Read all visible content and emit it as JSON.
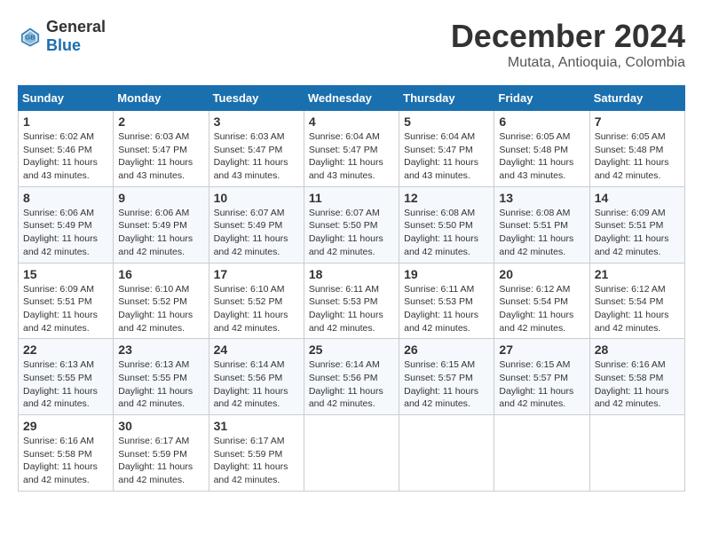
{
  "header": {
    "logo_general": "General",
    "logo_blue": "Blue",
    "month_title": "December 2024",
    "location": "Mutata, Antioquia, Colombia"
  },
  "days_of_week": [
    "Sunday",
    "Monday",
    "Tuesday",
    "Wednesday",
    "Thursday",
    "Friday",
    "Saturday"
  ],
  "weeks": [
    [
      {
        "day": "1",
        "sunrise": "6:02 AM",
        "sunset": "5:46 PM",
        "daylight": "11 hours and 43 minutes."
      },
      {
        "day": "2",
        "sunrise": "6:03 AM",
        "sunset": "5:47 PM",
        "daylight": "11 hours and 43 minutes."
      },
      {
        "day": "3",
        "sunrise": "6:03 AM",
        "sunset": "5:47 PM",
        "daylight": "11 hours and 43 minutes."
      },
      {
        "day": "4",
        "sunrise": "6:04 AM",
        "sunset": "5:47 PM",
        "daylight": "11 hours and 43 minutes."
      },
      {
        "day": "5",
        "sunrise": "6:04 AM",
        "sunset": "5:47 PM",
        "daylight": "11 hours and 43 minutes."
      },
      {
        "day": "6",
        "sunrise": "6:05 AM",
        "sunset": "5:48 PM",
        "daylight": "11 hours and 43 minutes."
      },
      {
        "day": "7",
        "sunrise": "6:05 AM",
        "sunset": "5:48 PM",
        "daylight": "11 hours and 42 minutes."
      }
    ],
    [
      {
        "day": "8",
        "sunrise": "6:06 AM",
        "sunset": "5:49 PM",
        "daylight": "11 hours and 42 minutes."
      },
      {
        "day": "9",
        "sunrise": "6:06 AM",
        "sunset": "5:49 PM",
        "daylight": "11 hours and 42 minutes."
      },
      {
        "day": "10",
        "sunrise": "6:07 AM",
        "sunset": "5:49 PM",
        "daylight": "11 hours and 42 minutes."
      },
      {
        "day": "11",
        "sunrise": "6:07 AM",
        "sunset": "5:50 PM",
        "daylight": "11 hours and 42 minutes."
      },
      {
        "day": "12",
        "sunrise": "6:08 AM",
        "sunset": "5:50 PM",
        "daylight": "11 hours and 42 minutes."
      },
      {
        "day": "13",
        "sunrise": "6:08 AM",
        "sunset": "5:51 PM",
        "daylight": "11 hours and 42 minutes."
      },
      {
        "day": "14",
        "sunrise": "6:09 AM",
        "sunset": "5:51 PM",
        "daylight": "11 hours and 42 minutes."
      }
    ],
    [
      {
        "day": "15",
        "sunrise": "6:09 AM",
        "sunset": "5:51 PM",
        "daylight": "11 hours and 42 minutes."
      },
      {
        "day": "16",
        "sunrise": "6:10 AM",
        "sunset": "5:52 PM",
        "daylight": "11 hours and 42 minutes."
      },
      {
        "day": "17",
        "sunrise": "6:10 AM",
        "sunset": "5:52 PM",
        "daylight": "11 hours and 42 minutes."
      },
      {
        "day": "18",
        "sunrise": "6:11 AM",
        "sunset": "5:53 PM",
        "daylight": "11 hours and 42 minutes."
      },
      {
        "day": "19",
        "sunrise": "6:11 AM",
        "sunset": "5:53 PM",
        "daylight": "11 hours and 42 minutes."
      },
      {
        "day": "20",
        "sunrise": "6:12 AM",
        "sunset": "5:54 PM",
        "daylight": "11 hours and 42 minutes."
      },
      {
        "day": "21",
        "sunrise": "6:12 AM",
        "sunset": "5:54 PM",
        "daylight": "11 hours and 42 minutes."
      }
    ],
    [
      {
        "day": "22",
        "sunrise": "6:13 AM",
        "sunset": "5:55 PM",
        "daylight": "11 hours and 42 minutes."
      },
      {
        "day": "23",
        "sunrise": "6:13 AM",
        "sunset": "5:55 PM",
        "daylight": "11 hours and 42 minutes."
      },
      {
        "day": "24",
        "sunrise": "6:14 AM",
        "sunset": "5:56 PM",
        "daylight": "11 hours and 42 minutes."
      },
      {
        "day": "25",
        "sunrise": "6:14 AM",
        "sunset": "5:56 PM",
        "daylight": "11 hours and 42 minutes."
      },
      {
        "day": "26",
        "sunrise": "6:15 AM",
        "sunset": "5:57 PM",
        "daylight": "11 hours and 42 minutes."
      },
      {
        "day": "27",
        "sunrise": "6:15 AM",
        "sunset": "5:57 PM",
        "daylight": "11 hours and 42 minutes."
      },
      {
        "day": "28",
        "sunrise": "6:16 AM",
        "sunset": "5:58 PM",
        "daylight": "11 hours and 42 minutes."
      }
    ],
    [
      {
        "day": "29",
        "sunrise": "6:16 AM",
        "sunset": "5:58 PM",
        "daylight": "11 hours and 42 minutes."
      },
      {
        "day": "30",
        "sunrise": "6:17 AM",
        "sunset": "5:59 PM",
        "daylight": "11 hours and 42 minutes."
      },
      {
        "day": "31",
        "sunrise": "6:17 AM",
        "sunset": "5:59 PM",
        "daylight": "11 hours and 42 minutes."
      },
      null,
      null,
      null,
      null
    ]
  ],
  "labels": {
    "sunrise_prefix": "Sunrise: ",
    "sunset_prefix": "Sunset: ",
    "daylight_label": "Daylight: "
  }
}
